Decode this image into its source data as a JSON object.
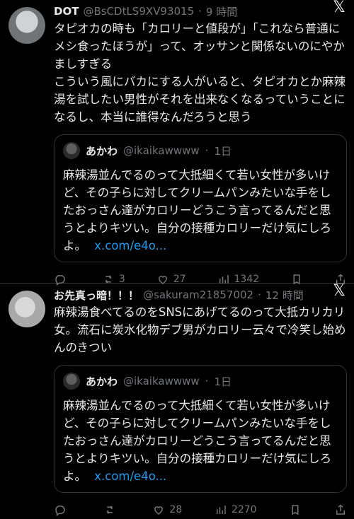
{
  "tweets": [
    {
      "author": {
        "name": "DOT",
        "handle": "@BsCDtLS9XV93015",
        "time": "9 時間"
      },
      "text_lines": [
        "タピオカの時も「カロリーと値段が」「これなら普通にメシ食ったほうが」って、オッサンと関係ないのにやかましすぎる",
        "こういう風にバカにする人がいると、タピオカとか麻辣湯を試したい男性がそれを出来なくなるっていうことになるし、本当に誰得なんだろうと思う"
      ],
      "quote": {
        "name": "あかわ",
        "handle": "@ikaikawwww",
        "time": "1日",
        "text": "麻辣湯並んでるのって大抵細くて若い女性が多いけど、その子らに対してクリームパンみたいな手をしたおっさん達がカロリーどうこう言ってるんだと思うとよりキツい。自分の接種カロリーだけ気にしろよ。",
        "link": "x.com/e4o..."
      },
      "actions": {
        "reply": "",
        "retweet": "3",
        "like": "27",
        "views": "1342"
      }
    },
    {
      "author": {
        "name": "お先真っ暗！！！",
        "handle": "@sakuram21857002",
        "time": "12 時間"
      },
      "text_lines": [
        "麻辣湯食べてるのをSNSにあげてるのって大抵カリカリ女。流石に炭水化物デブ男がカロリー云々で冷笑し始めんのきつい"
      ],
      "quote": {
        "name": "あかわ",
        "handle": "@ikaikawwww",
        "time": "1日",
        "text": "麻辣湯並んでるのって大抵細くて若い女性が多いけど、その子らに対してクリームパンみたいな手をしたおっさん達がカロリーどうこう言ってるんだと思うとよりキツい。自分の接種カロリーだけ気にしろよ。",
        "link": "x.com/e4o..."
      },
      "actions": {
        "reply": "",
        "retweet": "",
        "like": "28",
        "views": "2270"
      }
    }
  ]
}
